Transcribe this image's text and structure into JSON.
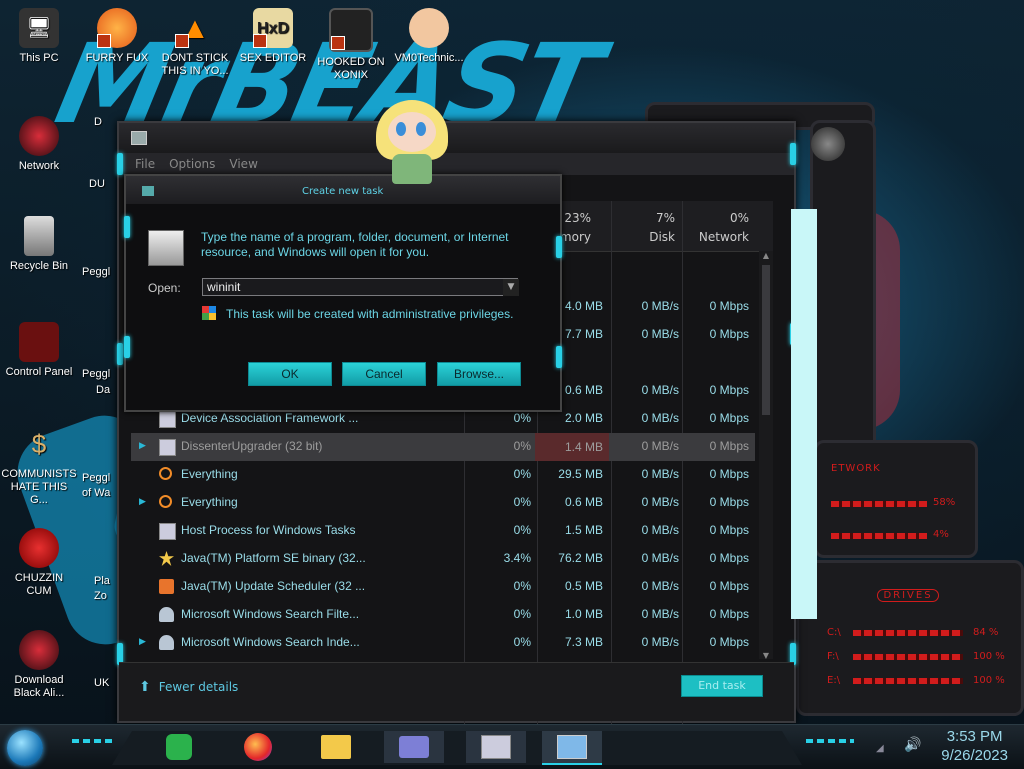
{
  "desktop": {
    "icons": [
      {
        "label": "This PC",
        "icon": "computer-icon"
      },
      {
        "label": "FURRY FUX",
        "icon": "firefox-icon"
      },
      {
        "label": "DONT STICK THIS IN YO...",
        "icon": "vlc-icon"
      },
      {
        "label": "SEX EDITOR",
        "icon": "hxd-icon"
      },
      {
        "label": "HOOKED ON XONIX",
        "icon": "game-icon"
      },
      {
        "label": "VM0Technic...",
        "icon": "doctor-icon"
      },
      {
        "label": "Network",
        "icon": "network-icon"
      },
      {
        "label": "Recycle Bin",
        "icon": "recycle-bin-icon"
      },
      {
        "label": "Control Panel",
        "icon": "control-panel-icon"
      },
      {
        "label": "COMMUNISTS HATE THIS G...",
        "icon": "money-bag-icon"
      },
      {
        "label": "CHUZZIN CUM",
        "icon": "chuzzle-icon"
      },
      {
        "label": "Download Black Ali...",
        "icon": "alien-icon"
      }
    ],
    "partial_labels": [
      "D",
      "DU",
      "Peggl",
      "Peggl",
      "Da",
      "Peggl",
      "of Wa",
      "Pla",
      "Zo",
      "UK"
    ],
    "widget_network_label": "ETWORK",
    "widget_network_vals": [
      "58%",
      "4%"
    ],
    "widget_drives_label": "DRIVES",
    "widget_drives": [
      {
        "label": "C:\\",
        "value": "84 %"
      },
      {
        "label": "F:\\",
        "value": "100 %"
      },
      {
        "label": "E:\\",
        "value": "100 %"
      }
    ]
  },
  "taskmanager": {
    "menu": [
      "File",
      "Options",
      "View"
    ],
    "header": {
      "cpu_pct": "",
      "mem_pct": "23%",
      "mem_label": "Memory",
      "disk_pct": "7%",
      "disk_label": "Disk",
      "net_pct": "0%",
      "net_label": "Network"
    },
    "rows": [
      {
        "name": "",
        "cpu": "",
        "mem": "4.0 MB",
        "disk": "0 MB/s",
        "net": "0 Mbps",
        "icon": "",
        "arrow": false
      },
      {
        "name": "",
        "cpu": "",
        "mem": "7.7 MB",
        "disk": "0 MB/s",
        "net": "0 Mbps",
        "icon": "",
        "arrow": false
      },
      {
        "name": "",
        "cpu": "",
        "mem": "",
        "disk": "",
        "net": "",
        "icon": "",
        "arrow": false
      },
      {
        "name": "",
        "cpu": "",
        "mem": "0.6 MB",
        "disk": "0 MB/s",
        "net": "0 Mbps",
        "icon": "",
        "arrow": false
      },
      {
        "name": "Device Association Framework ...",
        "cpu": "0%",
        "mem": "2.0 MB",
        "disk": "0 MB/s",
        "net": "0 Mbps",
        "icon": "window-icon",
        "arrow": false
      },
      {
        "name": "DissenterUpgrader (32 bit)",
        "cpu": "0%",
        "mem": "1.4 MB",
        "disk": "0 MB/s",
        "net": "0 Mbps",
        "icon": "window-icon",
        "arrow": true,
        "selected": true
      },
      {
        "name": "Everything",
        "cpu": "0%",
        "mem": "29.5 MB",
        "disk": "0 MB/s",
        "net": "0 Mbps",
        "icon": "magnifier-icon",
        "arrow": false
      },
      {
        "name": "Everything",
        "cpu": "0%",
        "mem": "0.6 MB",
        "disk": "0 MB/s",
        "net": "0 Mbps",
        "icon": "magnifier-icon",
        "arrow": true
      },
      {
        "name": "Host Process for Windows Tasks",
        "cpu": "0%",
        "mem": "1.5 MB",
        "disk": "0 MB/s",
        "net": "0 Mbps",
        "icon": "window-icon",
        "arrow": false
      },
      {
        "name": "Java(TM) Platform SE binary (32...",
        "cpu": "3.4%",
        "mem": "76.2 MB",
        "disk": "0 MB/s",
        "net": "0 Mbps",
        "icon": "star-icon",
        "arrow": false
      },
      {
        "name": "Java(TM) Update Scheduler (32 ...",
        "cpu": "0%",
        "mem": "0.5 MB",
        "disk": "0 MB/s",
        "net": "0 Mbps",
        "icon": "java-icon",
        "arrow": false
      },
      {
        "name": "Microsoft Windows Search Filte...",
        "cpu": "0%",
        "mem": "1.0 MB",
        "disk": "0 MB/s",
        "net": "0 Mbps",
        "icon": "person-icon",
        "arrow": false
      },
      {
        "name": "Microsoft Windows Search Inde...",
        "cpu": "0%",
        "mem": "7.3 MB",
        "disk": "0 MB/s",
        "net": "0 Mbps",
        "icon": "person-icon",
        "arrow": true
      }
    ],
    "fewer_details": "Fewer details",
    "end_task": "End task"
  },
  "run_dialog": {
    "title_overlay": "Create new task",
    "description": "Type the name of a program, folder, document, or Internet resource, and Windows will open it for you.",
    "open_label": "Open:",
    "open_value": "wininit",
    "admin_note": "This task will be created with administrative privileges.",
    "ok": "OK",
    "cancel": "Cancel",
    "browse": "Browse..."
  },
  "taskbar": {
    "time": "3:53 PM",
    "date": "9/26/2023",
    "apps": [
      "feedly-icon",
      "firefox-icon",
      "file-explorer-icon",
      "card-icon",
      "task-manager-icon",
      "run-icon"
    ]
  }
}
